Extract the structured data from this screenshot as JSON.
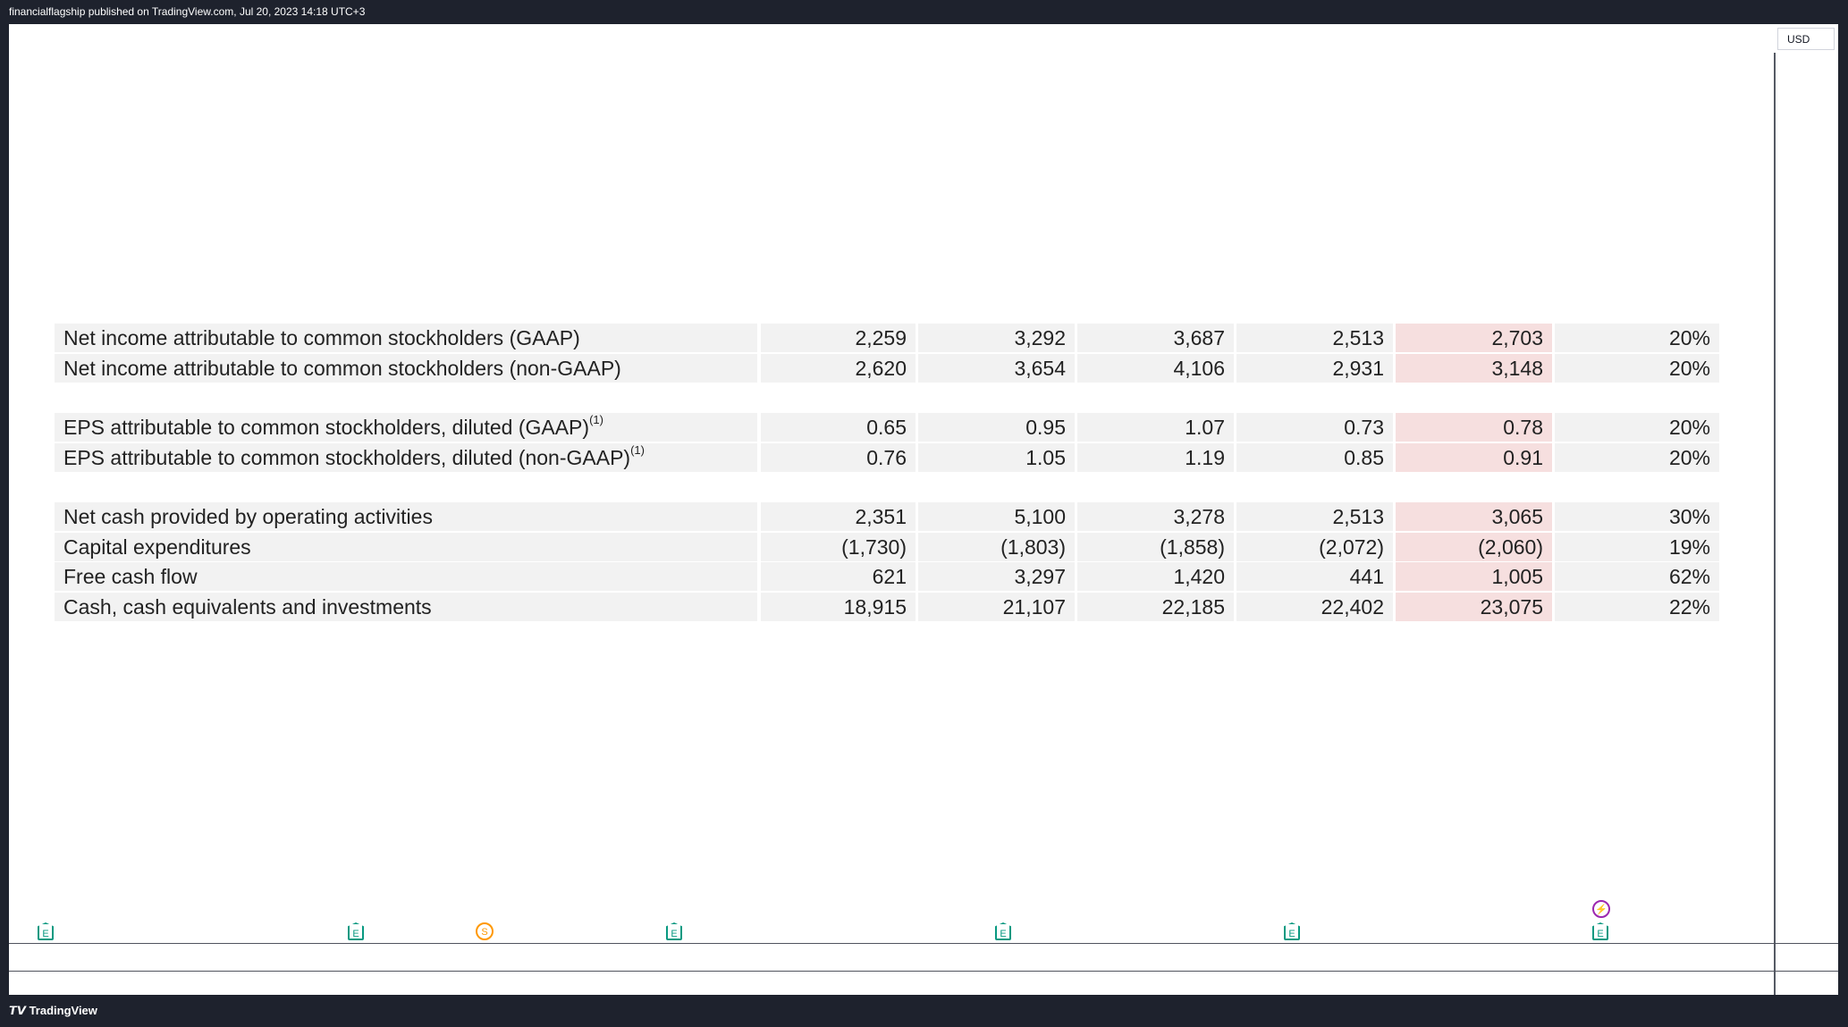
{
  "header": {
    "publisher_text": "financialflagship published on TradingView.com, Jul 20, 2023 14:18 UTC+3"
  },
  "price_scale": {
    "currency": "USD"
  },
  "table": {
    "groups": [
      {
        "rows": [
          {
            "label": "Net income attributable to common stockholders (GAAP)",
            "sup": "",
            "values": [
              "2,259",
              "3,292",
              "3,687",
              "2,513",
              "2,703",
              "20%"
            ]
          },
          {
            "label": "Net income attributable to common stockholders (non-GAAP)",
            "sup": "",
            "values": [
              "2,620",
              "3,654",
              "4,106",
              "2,931",
              "3,148",
              "20%"
            ]
          }
        ]
      },
      {
        "rows": [
          {
            "label": "EPS attributable to common stockholders, diluted (GAAP)",
            "sup": "(1)",
            "values": [
              "0.65",
              "0.95",
              "1.07",
              "0.73",
              "0.78",
              "20%"
            ]
          },
          {
            "label": "EPS attributable to common stockholders, diluted (non-GAAP)",
            "sup": "(1)",
            "values": [
              "0.76",
              "1.05",
              "1.19",
              "0.85",
              "0.91",
              "20%"
            ]
          }
        ]
      },
      {
        "rows": [
          {
            "label": "Net cash provided by operating activities",
            "sup": "",
            "values": [
              "2,351",
              "5,100",
              "3,278",
              "2,513",
              "3,065",
              "30%"
            ]
          },
          {
            "label": "Capital expenditures",
            "sup": "",
            "values": [
              "(1,730)",
              "(1,803)",
              "(1,858)",
              "(2,072)",
              "(2,060)",
              "19%"
            ]
          },
          {
            "label": "Free cash flow",
            "sup": "",
            "values": [
              "621",
              "3,297",
              "1,420",
              "441",
              "1,005",
              "62%"
            ]
          },
          {
            "label": "Cash, cash equivalents and investments",
            "sup": "",
            "values": [
              "18,915",
              "21,107",
              "22,185",
              "22,402",
              "23,075",
              "22%"
            ]
          }
        ]
      }
    ],
    "highlight_color": "#f6dfdf"
  },
  "markers": [
    {
      "type": "earnings",
      "glyph": "E",
      "icon": "earnings-icon"
    },
    {
      "type": "earnings",
      "glyph": "E",
      "icon": "earnings-icon"
    },
    {
      "type": "dividend",
      "glyph": "S",
      "icon": "dividend-icon"
    },
    {
      "type": "earnings",
      "glyph": "E",
      "icon": "earnings-icon"
    },
    {
      "type": "earnings",
      "glyph": "E",
      "icon": "earnings-icon"
    },
    {
      "type": "earnings",
      "glyph": "E",
      "icon": "earnings-icon"
    },
    {
      "type": "earnings",
      "glyph": "E",
      "icon": "earnings-icon"
    },
    {
      "type": "breaking-news",
      "glyph": "⚡",
      "icon": "lightning-icon"
    }
  ],
  "footer": {
    "brand": "TradingView"
  }
}
